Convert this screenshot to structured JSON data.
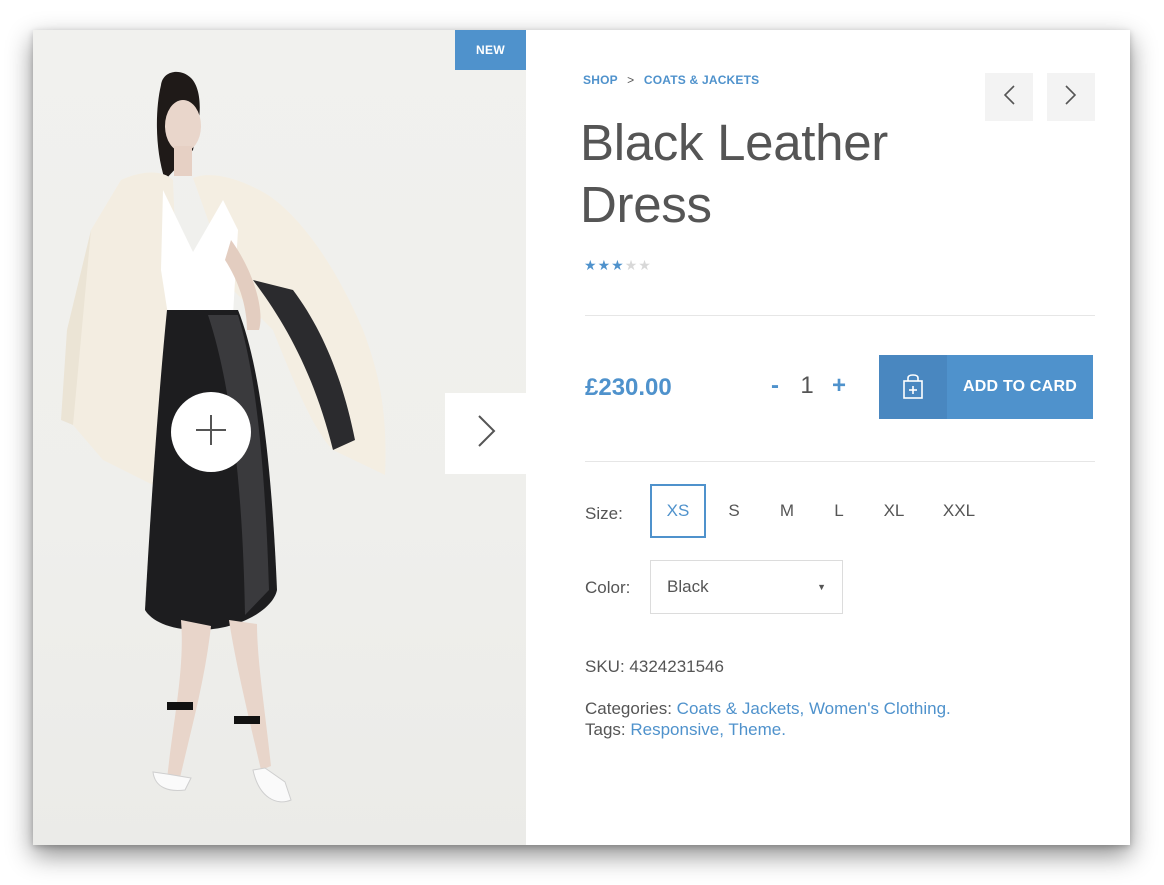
{
  "product": {
    "badge": "NEW",
    "title": "Black Leather Dress",
    "rating": 3,
    "rating_max": 5,
    "price": "£230.00",
    "quantity": "1",
    "qty_minus": "-",
    "qty_plus": "+",
    "add_button_label": "ADD TO CARD",
    "size_label": "Size:",
    "sizes": [
      "XS",
      "S",
      "M",
      "L",
      "XL",
      "XXL"
    ],
    "selected_size": "XS",
    "color_label": "Color:",
    "color_value": "Black",
    "sku_label": "SKU:",
    "sku_value": "4324231546",
    "categories_label": "Categories:",
    "categories_value": "Coats & Jackets, Women's Clothing.",
    "tags_label": "Tags:",
    "tags_value": "Responsive, Theme."
  },
  "breadcrumb": {
    "shop": "SHOP",
    "separator": ">",
    "category": "COATS & JACKETS"
  },
  "icons": {
    "prev": "chevron-left-icon",
    "next": "chevron-right-icon",
    "zoom": "plus-icon",
    "cart": "shopping-bag-icon",
    "dropdown": "caret-down-icon"
  },
  "colors": {
    "accent": "#4f92cc",
    "text": "#555555"
  }
}
